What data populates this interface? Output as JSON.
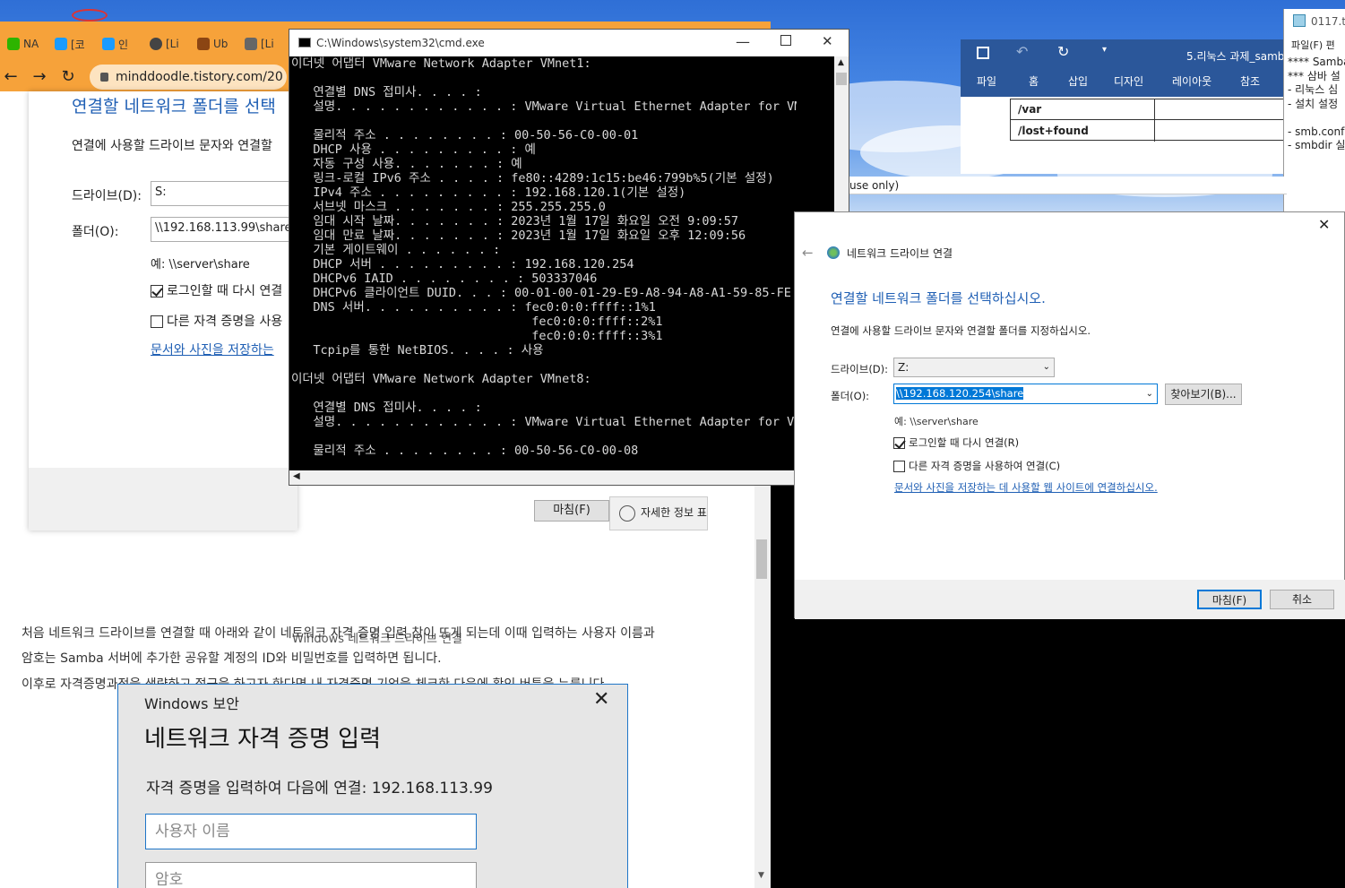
{
  "browser": {
    "tabs": [
      {
        "label": "NA",
        "color": "#2db400"
      },
      {
        "label": "[코",
        "color": "#1a9bff"
      },
      {
        "label": "인",
        "color": "#1a9bff"
      },
      {
        "label": "[Li",
        "color": "#444444"
      },
      {
        "label": "Ub",
        "color": "#8b4513"
      },
      {
        "label": "[Li",
        "color": "#666666"
      }
    ],
    "url": "minddoodle.tistory.com/20",
    "accent": "#f6a23a"
  },
  "blog": {
    "ss_title": "연결할 네트워크 폴더를 선택",
    "ss_desc": "연결에 사용할 드라이브 문자와 연결할",
    "ss_drive_label": "드라이브(D):",
    "ss_drive_value": "S:",
    "ss_folder_label": "폴더(O):",
    "ss_folder_value": "\\\\192.168.113.99\\share",
    "ss_example": "예: \\\\server\\share",
    "ss_reconnect": "로그인할 때 다시 연결",
    "ss_other_cred": "다른 자격 증명을 사용",
    "ss_link": "문서와 사진을 저장하는",
    "ss_finish": "마침(F)",
    "ss_details": "자세한 정보 표시",
    "caption": "Windows 네트워크 드라이브 연결",
    "para1": "처음 네트워크 드라이브를 연결할 때 아래와 같이 네트워크 자격 증명 입력 창이 뜨게 되는데 이때 입력하는 사용자 이름과",
    "para2": "암호는 Samba 서버에 추가한 공유할 계정의 ID와 비밀번호를 입력하면 됩니다.",
    "para3": "이후로 자격증명과정을 생략하고 접근을 하고자 한다면 내 자격증명 기억을 체크한 다음에 확인 버튼을 누릅니다.",
    "sec_window": "Windows 보안",
    "sec_title": "네트워크 자격 증명 입력",
    "sec_desc": "자격 증명을 입력하여 다음에 연결: 192.168.113.99",
    "sec_user_placeholder": "사용자 이름",
    "sec_pass_placeholder": "암호"
  },
  "cmd": {
    "title": "C:\\Windows\\system32\\cmd.exe",
    "lines": [
      "이더넷 어댑터 VMware Network Adapter VMnet1:",
      "",
      "   연결별 DNS 접미사. . . . :",
      "   설명. . . . . . . . . . . . : VMware Virtual Ethernet Adapter for VMnet",
      "",
      "   물리적 주소 . . . . . . . . : 00-50-56-C0-00-01",
      "   DHCP 사용 . . . . . . . . . : 예",
      "   자동 구성 사용. . . . . . . : 예",
      "   링크-로컬 IPv6 주소 . . . . : fe80::4289:1c15:be46:799b%5(기본 설정)",
      "   IPv4 주소 . . . . . . . . . : 192.168.120.1(기본 설정)",
      "   서브넷 마스크 . . . . . . . : 255.255.255.0",
      "   임대 시작 날짜. . . . . . . : 2023년 1월 17일 화요일 오전 9:09:57",
      "   임대 만료 날짜. . . . . . . : 2023년 1월 17일 화요일 오후 12:09:56",
      "   기본 게이트웨이 . . . . . . :",
      "   DHCP 서버 . . . . . . . . . : 192.168.120.254",
      "   DHCPv6 IAID . . . . . . . . : 503337046",
      "   DHCPv6 클라이언트 DUID. . . : 00-01-00-01-29-E9-A8-94-A8-A1-59-85-FE",
      "   DNS 서버. . . . . . . . . . : fec0:0:0:ffff::1%1",
      "                                 fec0:0:0:ffff::2%1",
      "                                 fec0:0:0:ffff::3%1",
      "   Tcpip를 통한 NetBIOS. . . . : 사용",
      "",
      "이더넷 어댑터 VMware Network Adapter VMnet8:",
      "",
      "   연결별 DNS 접미사. . . . :",
      "   설명. . . . . . . . . . . . : VMware Virtual Ethernet Adapter for VMnet",
      "",
      "   물리적 주소 . . . . . . . . : 00-50-56-C0-00-08"
    ]
  },
  "word": {
    "doc_title": "5.리눅스 과제_samba",
    "tabs": [
      "파일",
      "홈",
      "삽입",
      "디자인",
      "레이아웃",
      "참조"
    ],
    "rows": [
      "/var",
      "/lost+found"
    ],
    "ribbon_color": "#2b579a"
  },
  "notepad": {
    "title": "0117.t",
    "menu": "파일(F)  편",
    "lines": [
      "**** Samba",
      "",
      "*** 삼바 설",
      "- 리눅스 심",
      "- 설치 설정",
      "",
      "- smb.conf",
      "- smbdir 실"
    ]
  },
  "strip_text": "use only)",
  "netdialog": {
    "header": "네트워크 드라이브 연결",
    "title": "연결할 네트워크 폴더를 선택하십시오.",
    "desc": "연결에 사용할 드라이브 문자와 연결할 폴더를 지정하십시오.",
    "drive_label": "드라이브(D):",
    "drive_value": "Z:",
    "folder_label": "폴더(O):",
    "folder_value": "\\\\192.168.120.254\\share",
    "browse": "찾아보기(B)...",
    "example": "예: \\\\server\\share",
    "reconnect": "로그인할 때 다시 연결(R)",
    "other_cred": "다른 자격 증명을 사용하여 연결(C)",
    "link": "문서와 사진을 저장하는 데 사용할 웹 사이트에 연결하십시오.",
    "finish": "마침(F)",
    "cancel": "취소",
    "title_color": "#1f5fb4"
  }
}
